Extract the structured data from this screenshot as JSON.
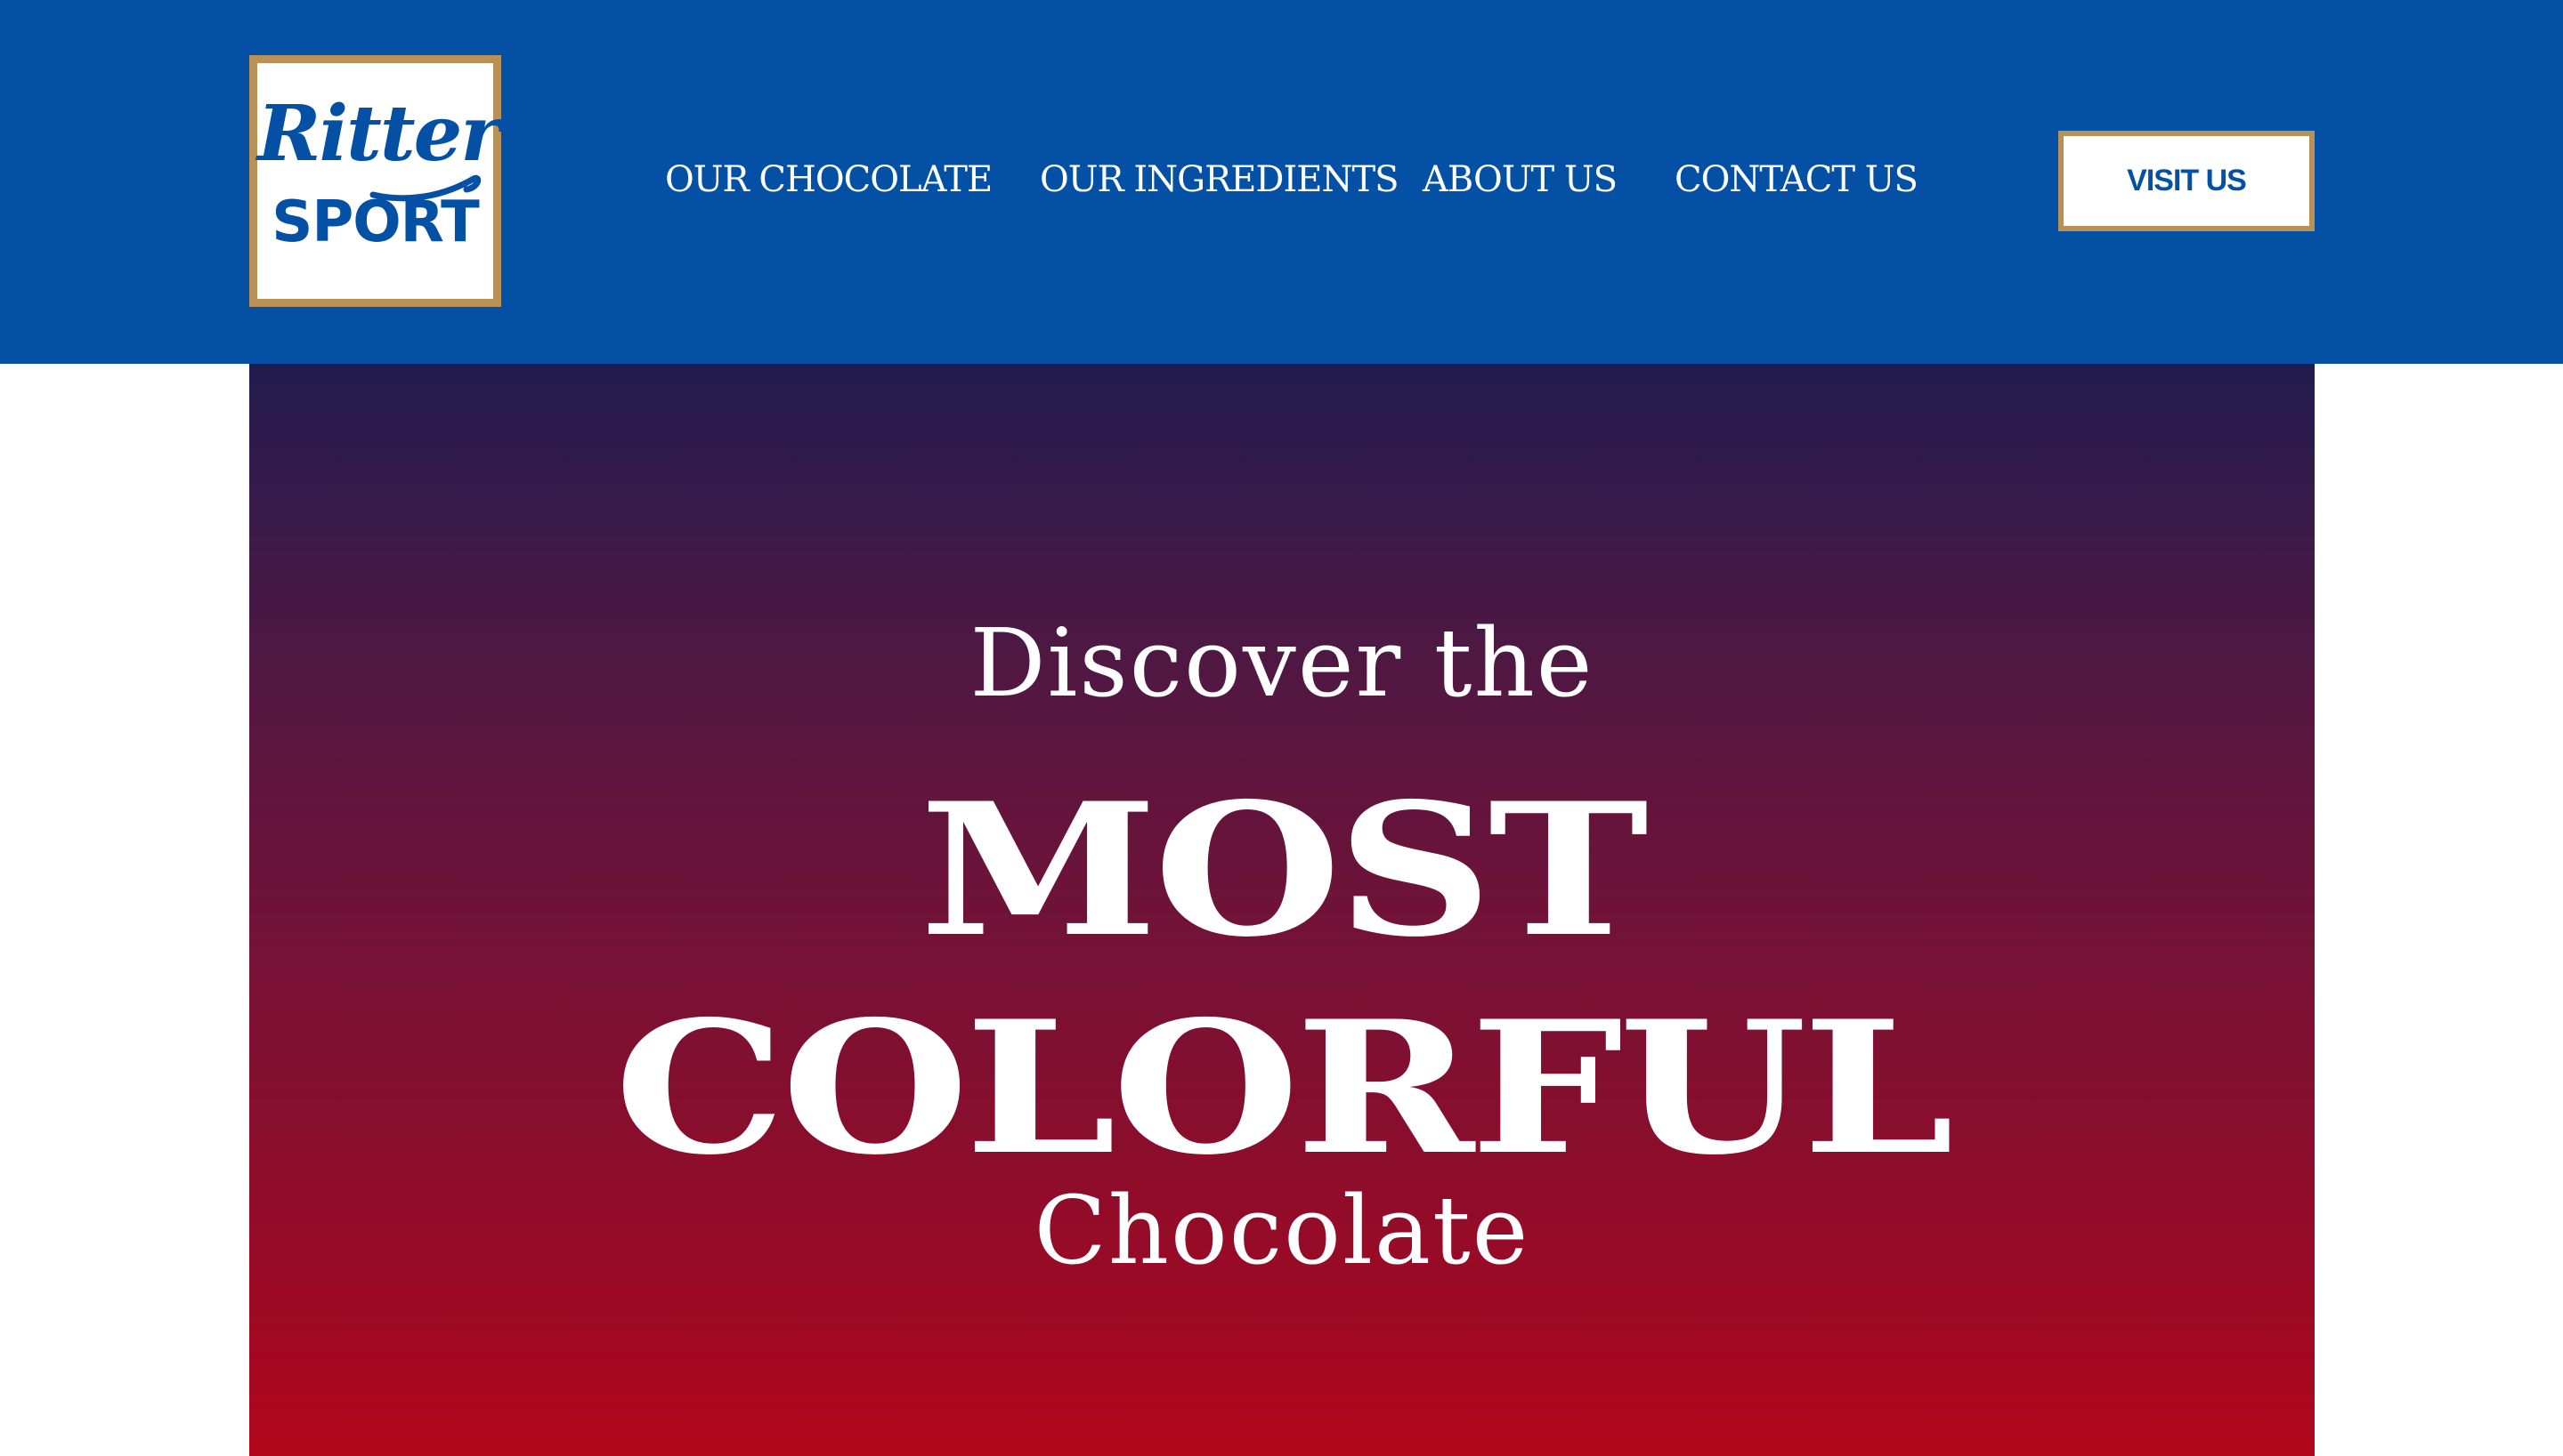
{
  "brand": {
    "logo_top": "Ritter",
    "logo_bottom": "SPORT",
    "colors": {
      "blue": "#0350a5",
      "gold": "#b99157",
      "hero_top": "#221c4e",
      "hero_bottom": "#b1061b"
    }
  },
  "nav": {
    "items": [
      {
        "label": "OUR CHOCOLATE"
      },
      {
        "label": "OUR INGREDIENTS"
      },
      {
        "label": "ABOUT US"
      },
      {
        "label": "CONTACT US"
      }
    ]
  },
  "cta": {
    "label": "VISIT US"
  },
  "hero": {
    "line1": "Discover the",
    "line2": "MOST",
    "line3": "COLORFUL",
    "line4": "Chocolate"
  }
}
